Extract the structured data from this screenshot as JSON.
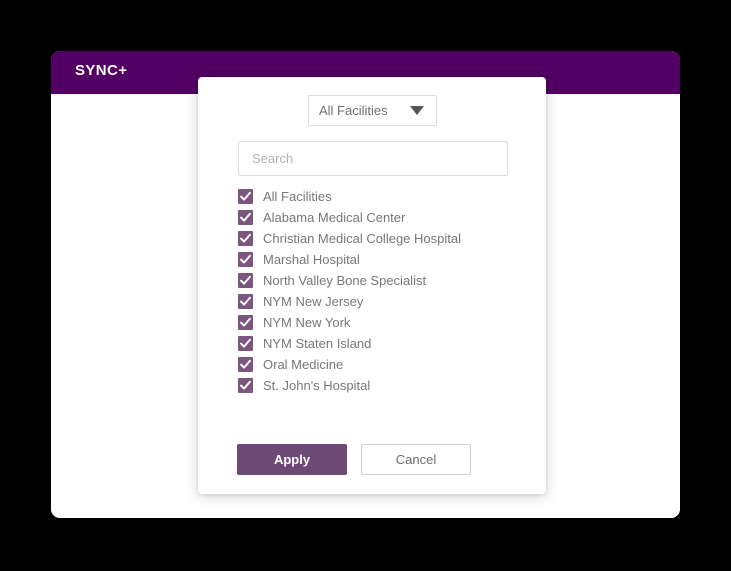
{
  "app": {
    "logo_text": "SYNC+",
    "header_color": "#520063",
    "card_background": "#ffffff"
  },
  "modal": {
    "dropdown": {
      "selected_label": "All Facilities",
      "caret_icon": "chevron-down-icon"
    },
    "search": {
      "placeholder": "Search",
      "value": ""
    },
    "list_items": [
      {
        "label": "All Facilities",
        "checked": true
      },
      {
        "label": "Alabama Medical Center",
        "checked": true
      },
      {
        "label": "Christian Medical College Hospital",
        "checked": true
      },
      {
        "label": "Marshal Hospital",
        "checked": true
      },
      {
        "label": "North Valley Bone Specialist",
        "checked": true
      },
      {
        "label": "NYM New Jersey",
        "checked": true
      },
      {
        "label": "NYM New York",
        "checked": true
      },
      {
        "label": "NYM Staten Island",
        "checked": true
      },
      {
        "label": "Oral Medicine",
        "checked": true
      },
      {
        "label": "St. John's Hospital",
        "checked": true
      }
    ],
    "buttons": {
      "apply_label": "Apply",
      "cancel_label": "Cancel",
      "apply_color": "#6d4a75",
      "checkbox_color": "#7d5680"
    }
  }
}
